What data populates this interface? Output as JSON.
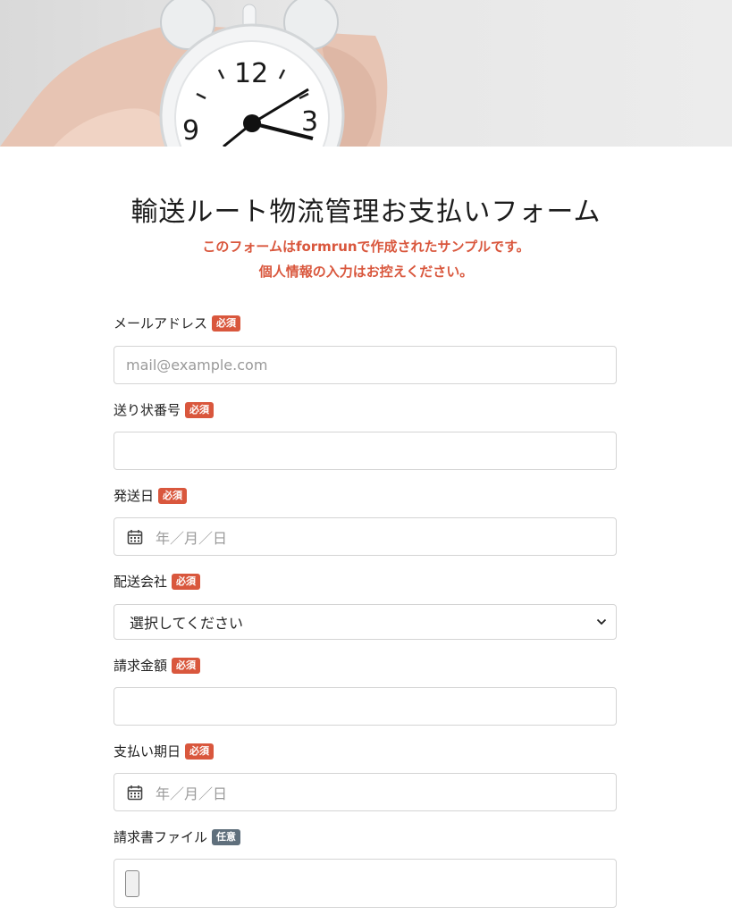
{
  "form": {
    "title": "輸送ルート物流管理お支払いフォーム",
    "notice_line1": "このフォームはformrunで作成されたサンプルです。",
    "notice_line2": "個人情報の入力はお控えください。"
  },
  "fields": {
    "email": {
      "label": "メールアドレス",
      "badge": "必須",
      "placeholder": "mail@example.com"
    },
    "tracking": {
      "label": "送り状番号",
      "badge": "必須",
      "value": ""
    },
    "ship_date": {
      "label": "発送日",
      "badge": "必須",
      "placeholder": "年／月／日"
    },
    "carrier": {
      "label": "配送会社",
      "badge": "必須",
      "selected": "選択してください"
    },
    "amount": {
      "label": "請求金額",
      "badge": "必須",
      "value": ""
    },
    "due_date": {
      "label": "支払い期日",
      "badge": "必須",
      "placeholder": "年／月／日"
    },
    "invoice_file": {
      "label": "請求書ファイル",
      "badge": "任意"
    }
  },
  "hero": {
    "clock_numerals": [
      "12",
      "3",
      "9"
    ]
  },
  "colors": {
    "required_badge": "#d9573d",
    "optional_badge": "#5f6f7c",
    "notice_text": "#d9573d"
  },
  "icons": {
    "date_field": "calendar-icon",
    "select_arrow": "chevron-down-icon"
  }
}
